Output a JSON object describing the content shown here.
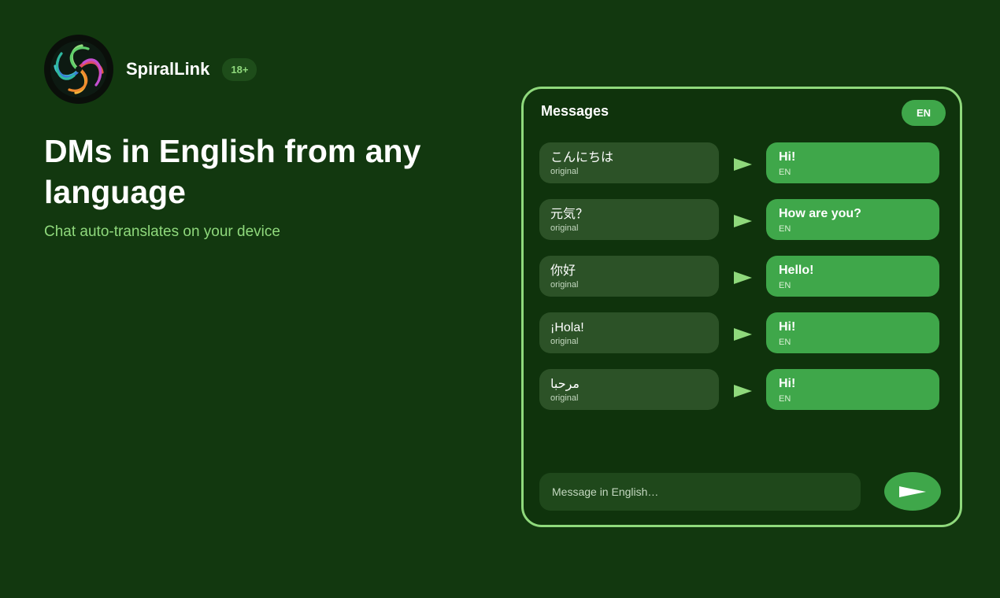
{
  "brand": {
    "name": "SpiralLink",
    "age_badge": "18+",
    "logo_icon": "spiral-logo-icon"
  },
  "hero": {
    "headline": "DMs in English from any language",
    "subhead": "Chat auto-translates on your device"
  },
  "chat": {
    "title": "Messages",
    "language": "EN",
    "messages": [
      {
        "original": "こんにちは",
        "original_label": "original",
        "translated": "Hi!",
        "translated_label": "EN"
      },
      {
        "original": "元気？",
        "original_label": "original",
        "translated": "How are you?",
        "translated_label": "EN"
      },
      {
        "original": "你好",
        "original_label": "original",
        "translated": "Hello!",
        "translated_label": "EN"
      },
      {
        "original": "¡Hola!",
        "original_label": "original",
        "translated": "Hi!",
        "translated_label": "EN"
      },
      {
        "original": "مرحبا",
        "original_label": "original",
        "translated": "Hi!",
        "translated_label": "EN"
      }
    ],
    "input_placeholder": "Message in English…",
    "input_value": "",
    "send_icon": "send-arrow-icon"
  },
  "colors": {
    "background": "#12380f",
    "panel": "#0f330c",
    "accent": "#3fa74a",
    "accent_light": "#8fd97c",
    "original_bubble": "#2c5227"
  }
}
